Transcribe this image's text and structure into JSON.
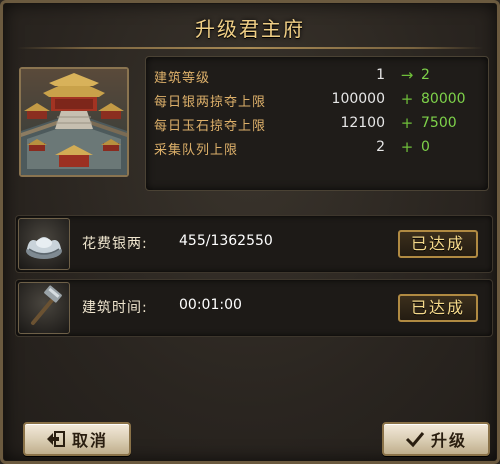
{
  "dialog": {
    "title": "升级君主府"
  },
  "stats": [
    {
      "label": "建筑等级",
      "current": "1",
      "operator": "→",
      "next": "2"
    },
    {
      "label": "每日银两掠夺上限",
      "current": "100000",
      "operator": "+",
      "next": "80000"
    },
    {
      "label": "每日玉石掠夺上限",
      "current": "12100",
      "operator": "+",
      "next": "7500"
    },
    {
      "label": "采集队列上限",
      "current": "2",
      "operator": "+",
      "next": "0"
    }
  ],
  "requirements": [
    {
      "icon": "silver-ingot-icon",
      "label": "花费银两:",
      "value": "455/1362550",
      "status": "已达成"
    },
    {
      "icon": "hammer-icon",
      "label": "建筑时间:",
      "value": "00:01:00",
      "status": "已达成"
    }
  ],
  "buttons": {
    "cancel": "取消",
    "upgrade": "升级"
  },
  "colors": {
    "title": "#f0cf86",
    "stat_label": "#ddb06a",
    "increase": "#7ed24a",
    "badge_border": "#b08a42"
  }
}
